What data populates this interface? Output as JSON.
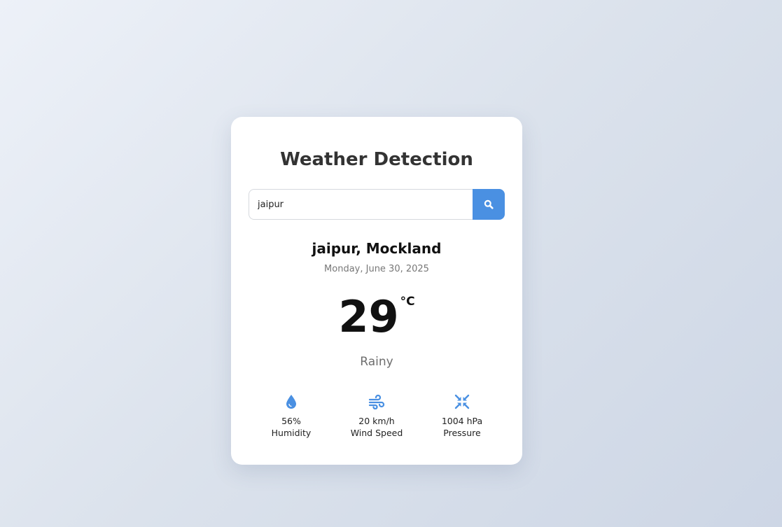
{
  "header": {
    "title": "Weather Detection"
  },
  "search": {
    "value": "jaipur",
    "placeholder": "",
    "button_icon": "search-icon"
  },
  "weather": {
    "location": "jaipur, Mockland",
    "date": "Monday, June 30, 2025",
    "temperature": "29",
    "unit": "°C",
    "condition": "Rainy"
  },
  "details": [
    {
      "icon": "droplet-icon",
      "value": "56%",
      "label": "Humidity"
    },
    {
      "icon": "wind-icon",
      "value": "20 km/h",
      "label": "Wind Speed"
    },
    {
      "icon": "compress-icon",
      "value": "1004 hPa",
      "label": "Pressure"
    }
  ],
  "colors": {
    "accent": "#4a90e2",
    "card": "#ffffff",
    "title": "#333333",
    "muted": "#777777"
  }
}
